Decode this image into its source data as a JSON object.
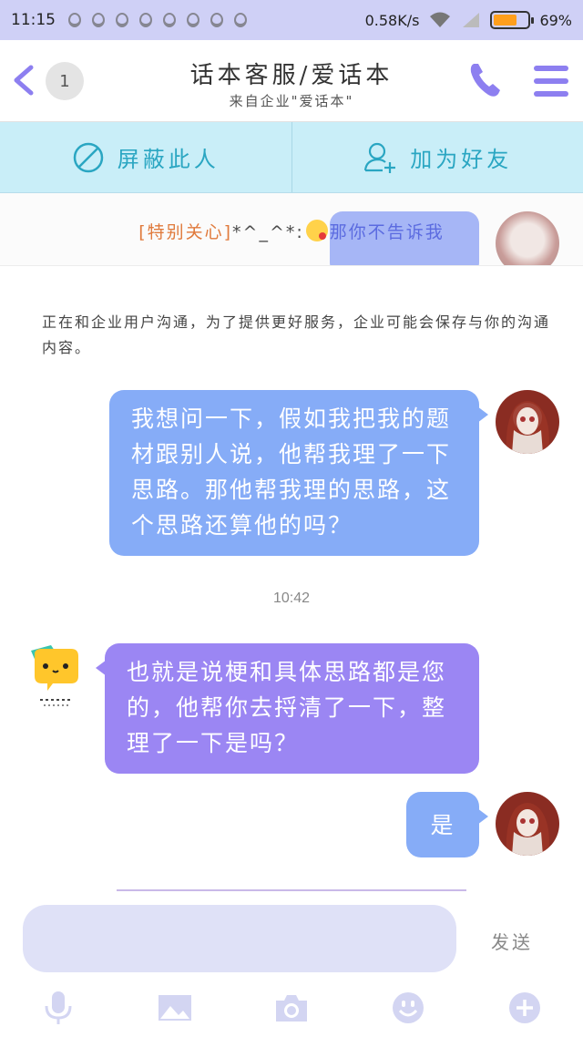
{
  "status_bar": {
    "time": "11:15",
    "network_speed": "0.58K/s",
    "battery_percent": "69%",
    "battery_level": 0.69
  },
  "header": {
    "badge_count": "1",
    "title": "话本客服/爱话本",
    "subtitle": "来自企业\"爱话本\""
  },
  "actions": {
    "block_label": "屏蔽此人",
    "add_friend_label": "加为好友"
  },
  "pinned": {
    "tag": "[特别关心]",
    "stars": "*^_^*:",
    "message": "那你不告诉我"
  },
  "notice": "正在和企业用户沟通，为了提供更好服务，企业可能会保存与你的沟通内容。",
  "messages": [
    {
      "from": "me",
      "text": "我想问一下，假如我把我的题材跟别人说，他帮我理了一下思路。那他帮我理的思路，这个思路还算他的吗？"
    },
    {
      "from": "agent",
      "text": "也就是说梗和具体思路都是您的，他帮你去捋清了一下，整理了一下是吗？"
    },
    {
      "from": "me",
      "text": "是"
    }
  ],
  "timestamp": "10:42",
  "composer": {
    "send_label": "发送"
  },
  "colors": {
    "accent": "#8d7ff0",
    "outgoing_bubble": "#86acf7",
    "incoming_bubble": "#9b86f3",
    "action_bar": "#c9eef8",
    "status_bar": "#cfd0f6"
  },
  "icons": {
    "toolbar": [
      "microphone-icon",
      "image-icon",
      "camera-icon",
      "emoji-icon",
      "plus-icon"
    ]
  }
}
